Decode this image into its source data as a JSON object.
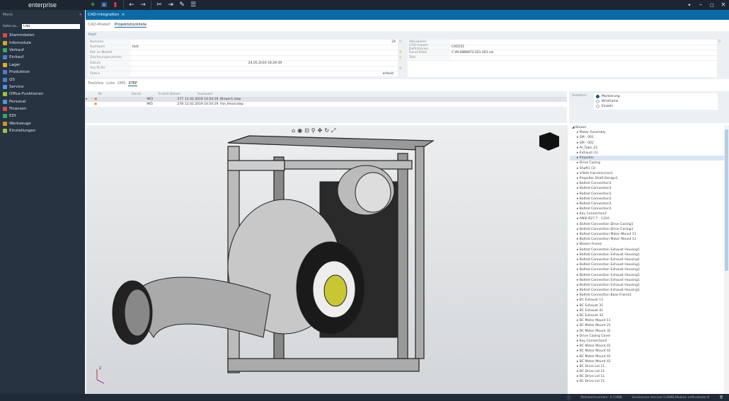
{
  "app": {
    "brand": "enterprise"
  },
  "toolbar": {
    "icons": [
      "plus-icon",
      "save-icon",
      "delete-icon",
      "back-icon",
      "forward-icon",
      "tools-icon",
      "import-icon",
      "pin-icon",
      "list-icon"
    ]
  },
  "sidebar": {
    "title": "Menü",
    "close": "×",
    "goto_label": "Gehe zu...",
    "goto_value": "CAD",
    "items": [
      {
        "label": "Stammdaten",
        "color": "#e0483e"
      },
      {
        "label": "Infomodule",
        "color": "#d8a820"
      },
      {
        "label": "Verkauf",
        "color": "#3aa858"
      },
      {
        "label": "Einkauf",
        "color": "#4a7fd0"
      },
      {
        "label": "Lager",
        "color": "#e0b020"
      },
      {
        "label": "Produktion",
        "color": "#4a7fd0"
      },
      {
        "label": "QS",
        "color": "#4a7fd0"
      },
      {
        "label": "Service",
        "color": "#4a9ae0"
      },
      {
        "label": "Office-Funktionen",
        "color": "#a0c040"
      },
      {
        "label": "Personal",
        "color": "#4a9ae0"
      },
      {
        "label": "Finanzen",
        "color": "#e0483e"
      },
      {
        "label": "EDI",
        "color": "#3aa858"
      },
      {
        "label": "Werkzeuge",
        "color": "#e09020"
      },
      {
        "label": "Einstellungen",
        "color": "#a0c040"
      }
    ]
  },
  "tab": {
    "title": "CAD-Integration",
    "close": "×"
  },
  "subtabs": [
    "CAD-Modell",
    "Projektstückliste"
  ],
  "kopf": {
    "title": "Kopf",
    "left": [
      {
        "label": "Nummer",
        "value": "24"
      },
      {
        "label": "Suchwort",
        "value": "test"
      },
      {
        "label": "Ref. zu Modell",
        "value": ""
      },
      {
        "label": "Zeichnungsnummer",
        "value": ""
      },
      {
        "label": "Datum",
        "value": "24.05.2019 18:29:39"
      },
      {
        "label": "Aus Pj.Stl.",
        "value": ""
      },
      {
        "label": "Status",
        "value": "erfasst"
      }
    ],
    "right": [
      {
        "label": "Mitarbeiter",
        "value": ""
      },
      {
        "label": "CAD Import-Definitionen",
        "value": "CAD151"
      },
      {
        "label": "Excel-Datei",
        "value": "C:\\M.0886873.021.001.xls"
      },
      {
        "label": "Text",
        "value": ""
      }
    ]
  },
  "lower_tabs": [
    "TreeView",
    "Liste",
    "DMS",
    "STEP"
  ],
  "grid": {
    "headers": [
      "Nr.",
      "DocId",
      "Erstell-Datum",
      "Suchwort"
    ],
    "rows": [
      {
        "nr": "963",
        "docid": "277",
        "date": "12.02.2019 14:54:19",
        "suchwort": "Blower1.step"
      },
      {
        "nr": "965",
        "docid": "278",
        "date": "12.02.2019 14:54:19",
        "suchwort": "Fan_Head.step"
      }
    ]
  },
  "selection": {
    "label": "Selektion",
    "options": [
      "Markierung",
      "Wireframe",
      "Einzeln"
    ],
    "selected": 0
  },
  "tree": {
    "root": "Blower",
    "selected_index": 5,
    "items": [
      "Motor Assembly",
      "SM - 001",
      "SM - 002",
      "Al_Tube_01",
      "Exhaust (1)",
      "Propeller",
      "Drive Casing",
      "Shaft1 (3)",
      "V-Belt transmiccion1",
      "Propeller Shaft Design1",
      "Bolted Connection1",
      "Bolted Connection1",
      "Bolted Connection1",
      "Bolted Connection1",
      "Bolted Connection1",
      "Bolted Connection1",
      "Key Connection2",
      "ANSI B27.7 - 1310",
      "Bolted Connection Drive Casing1",
      "Bolted Connection Drive Casing1",
      "Bolted Connection Motor Mount 11",
      "Bolted Connection Motor Mount 11",
      "Blower Frame",
      "Bolted Connection Exhaust Housing1",
      "Bolted Connection Exhaust Housing1",
      "Bolted Connection Exhaust Housing1",
      "Bolted Connection Exhaust Housing1",
      "Bolted Connection Exhaust Housing1",
      "Bolted Connection Exhaust Housing1",
      "Bolted Connection Exhaust Housing1",
      "Bolted Connection Exhaust Housing1",
      "Bolted Connection Exhaust Housing1",
      "Bolted Connection Base Frame1",
      "BC Exhaust 11",
      "BC Exhaust 31",
      "BC Exhaust 41",
      "BC Exhaust 32",
      "BC Motor Mount 11",
      "BC Motor Mount 21",
      "BC Motor Mount 31",
      "Drive Casing Cover",
      "Key Connection4",
      "BC Motor Mount 41",
      "BC Motor Mount 41",
      "BC Motor Mount 41",
      "BC Motor Mount 41",
      "BC Drive Lid 11",
      "BC Drive Lid 11",
      "BC Drive Lid 11",
      "BC Drive Lid 11"
    ]
  },
  "status": {
    "network": "Netzwerkverkehr: 0.53MB",
    "gestionare": "Gestionare stocare:118MB;Module nefinalizate:6"
  }
}
